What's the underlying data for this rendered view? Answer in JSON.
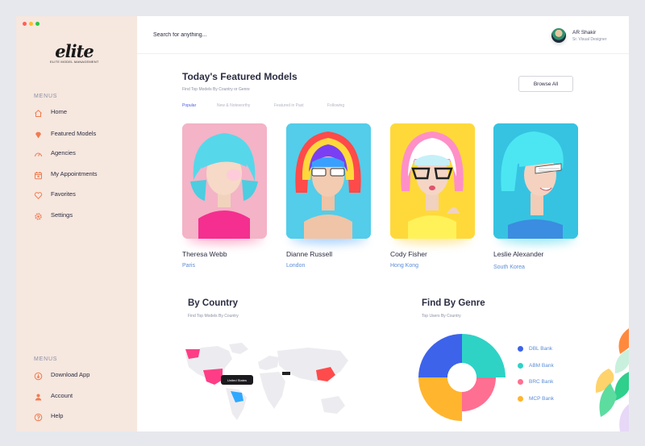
{
  "colors": {
    "sidebar_bg": "#f6e7df",
    "accent": "#f17b4d",
    "link": "#5b8dd6",
    "active_tab": "#4a5be0"
  },
  "window_controls": [
    "close",
    "minimize",
    "maximize"
  ],
  "brand": {
    "logo_text": "elite",
    "logo_tagline": "ELITE MODEL MANAGEMENT"
  },
  "sidebar": {
    "menu_heading": "MENUS",
    "items": [
      {
        "label": "Home",
        "icon": "home-icon"
      },
      {
        "label": "Featured Models",
        "icon": "diamond-icon"
      },
      {
        "label": "Agencies",
        "icon": "speedometer-icon"
      },
      {
        "label": "My Appointments",
        "icon": "calendar-icon"
      },
      {
        "label": "Favorites",
        "icon": "heart-icon"
      },
      {
        "label": "Settings",
        "icon": "gear-icon"
      }
    ],
    "menu_heading_2": "MENUS",
    "items_2": [
      {
        "label": "Download App",
        "icon": "download-icon"
      },
      {
        "label": "Account",
        "icon": "user-icon"
      },
      {
        "label": "Help",
        "icon": "help-icon"
      }
    ]
  },
  "search": {
    "placeholder": "Search for anything..."
  },
  "user": {
    "name": "AR Shakir",
    "role": "Sr. Visual Designer"
  },
  "featured": {
    "title": "Today's Featured Models",
    "subtitle": "Find Top Models By Country or Genre",
    "browse_label": "Browse All",
    "tabs": [
      "Popular",
      "New & Noteworthy",
      "Featured in Past",
      "Following"
    ],
    "models": [
      {
        "name": "Theresa Webb",
        "city": "Paris"
      },
      {
        "name": "Dianne Russell",
        "city": "London"
      },
      {
        "name": "Cody Fisher",
        "city": "Hong Kong"
      },
      {
        "name": "Leslie Alexander",
        "city": "South Korea"
      }
    ]
  },
  "by_country": {
    "title": "By Country",
    "subtitle": "Find Top Models By Country",
    "map_tooltip": "United States"
  },
  "by_genre": {
    "title": "Find By Genre",
    "subtitle": "Top Users By Country",
    "legend": [
      {
        "label": "DBL Bank",
        "color": "#3d63ea"
      },
      {
        "label": "ABM Bank",
        "color": "#2ed3c6"
      },
      {
        "label": "BRC Bank",
        "color": "#ff6f91"
      },
      {
        "label": "MCP Bank",
        "color": "#ffb52e"
      }
    ]
  }
}
